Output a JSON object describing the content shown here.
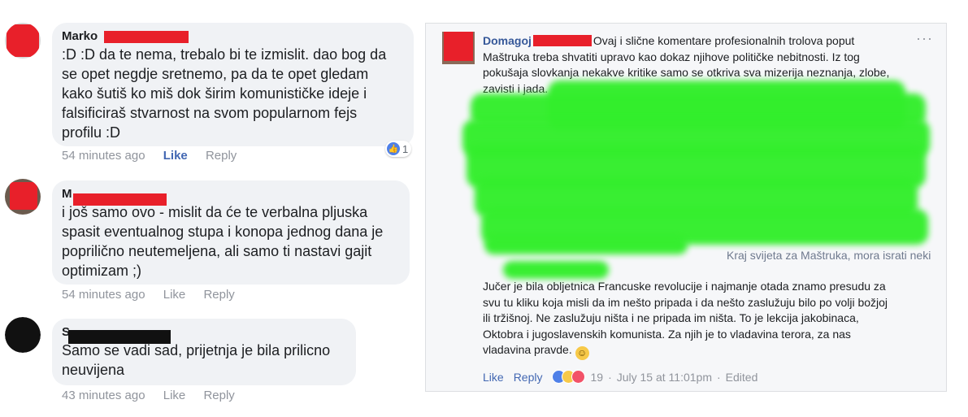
{
  "comments": [
    {
      "author": "Marko",
      "text_lines": [
        ":D :D da te nema, trebalo bi te izmislit. dao bog da",
        "se opet negdje sretnemo, pa da te opet gledam",
        "kako šutiš ko miš dok širim komunističke ideje i",
        "falsificiraš stvarnost na svom popularnom fejs",
        "profilu :D"
      ],
      "time": "54 minutes ago",
      "like_label": "Like",
      "reply_label": "Reply",
      "reaction_count": "1"
    },
    {
      "author": "M",
      "text_lines": [
        "i još samo ovo - mislit da će te verbalna pljuska",
        "spasit eventualnog stupa i konopa jednog dana je",
        "popriličnо neutemeljena, ali samo ti nastavi gajit",
        "optimizam ;)"
      ],
      "time": "54 minutes ago",
      "like_label": "Like",
      "reply_label": "Reply"
    },
    {
      "author": "S",
      "text_lines": [
        "Samo se vadi sad, prijetnja je bila prilicno",
        "neuvijena"
      ],
      "time": "43 minutes ago",
      "like_label": "Like",
      "reply_label": "Reply"
    }
  ],
  "post": {
    "author": "Domagoj",
    "text_lines": [
      "Ovaj i slične komentare profesionalnih trolova poput",
      "Maštruka treba shvatiti upravo kao dokaz njihove političke nebitnosti. Iz tog",
      "pokušaja slovkanja nekakve kritike samo se otkriva sva mizerija neznanja, zlobe,",
      "zavisti i jada."
    ],
    "partial_line": "Kraj svijeta za Maštruka, mora israti neki",
    "text_lines_2": [
      "Jučer je bila obljetnica Francuske revolucije i najmanje otada znamo presudu za",
      "svu tu kliku koja misli da im nešto pripada i da nešto zaslužuju bilo po volji božjoj",
      "ili tržišnoj. Ne zaslužuju ništa i ne pripada im ništa. To je lekcija jakobinaca,",
      "Oktobra i jugoslavenskih komunista. Za njih je to vladavina terora, za nas",
      "vladavina pravde."
    ],
    "more_label": "···",
    "like_label": "Like",
    "reply_label": "Reply",
    "reaction_count": "19",
    "time": "July 15 at 11:01pm",
    "edited_label": "Edited",
    "separator": "·"
  },
  "colors": {
    "redaction_red": "#e8202a",
    "redaction_green": "#33ee2c",
    "link_blue": "#4267b2"
  },
  "icons": [
    "avatar",
    "like-reaction-icon",
    "haha-reaction-icon",
    "love-reaction-icon",
    "smile-emoji-icon",
    "more-options-icon"
  ]
}
